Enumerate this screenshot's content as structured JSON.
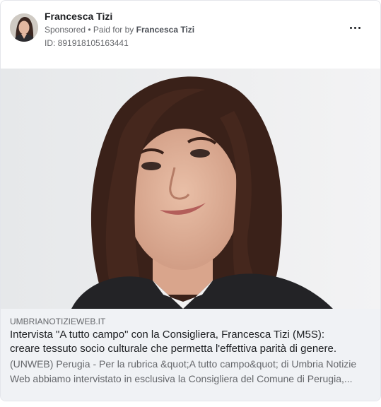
{
  "ad": {
    "advertiser_name": "Francesca Tizi",
    "sponsored_label": "Sponsored",
    "separator": " • ",
    "paid_for_prefix": "Paid for by ",
    "paid_for_by": "Francesca Tizi",
    "ad_id": "ID: 891918105163441",
    "more_icon": "more-horizontal-icon"
  },
  "link_preview": {
    "domain": "UMBRIANOTIZIEWEB.IT",
    "headline_line1": "Intervista \"A tutto campo\" con la Consigliera, Francesca Tizi (M5S):",
    "headline_line2": "creare tessuto socio culturale che permetta l'effettiva parità di genere.",
    "description_line1": "(UNWEB) Perugia - Per la rubrica &quot;A tutto campo&quot; di Umbria Notizie",
    "description_line2": "Web abbiamo intervistato in esclusiva la Consigliera del Comune di Perugia,..."
  },
  "colors": {
    "text_primary": "#1c1e21",
    "text_secondary": "#65676b",
    "footer_bg": "#f0f2f5",
    "border": "#e4e6eb"
  }
}
